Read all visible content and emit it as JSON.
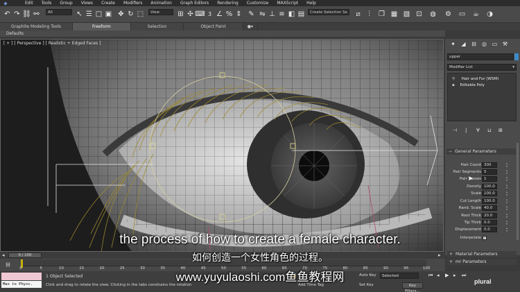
{
  "menu": [
    "Edit",
    "Tools",
    "Group",
    "Views",
    "Create",
    "Modifiers",
    "Animation",
    "Graph Editors",
    "Rendering",
    "Customize",
    "MAXScript",
    "Help"
  ],
  "toolbar": {
    "filter_all": "All",
    "view_select": "View",
    "selection_set": "Create Selection Se",
    "snap_num": "3"
  },
  "ribbon_tabs": [
    "Graphite Modeling Tools",
    "Freeform",
    "Selection",
    "Object Paint"
  ],
  "defaults_label": "Defaults",
  "viewport_label": "[ + ] [ Perspective ] [ Realistic + Edged Faces ]",
  "command_panel": {
    "object_name": "upper",
    "modifier_list_label": "Modifier List",
    "stack": [
      "Hair and Fur (WSM)",
      "Editable Poly"
    ],
    "rollouts": {
      "general": "General Parameters",
      "material": "Material Parameters",
      "mr": "mr Parameters"
    },
    "params": [
      {
        "label": "Hair Count",
        "value": "300"
      },
      {
        "label": "Hair Segments",
        "value": "5"
      },
      {
        "label": "Hair Passes",
        "value": "1"
      },
      {
        "label": "Density",
        "value": "100.0"
      },
      {
        "label": "Scale",
        "value": "100.0"
      },
      {
        "label": "Cut Length",
        "value": "100.0"
      },
      {
        "label": "Rand. Scale",
        "value": "40.0"
      },
      {
        "label": "Root Thick",
        "value": "20.0"
      },
      {
        "label": "Tip Thick",
        "value": "0.0"
      },
      {
        "label": "Displacement",
        "value": "0.0"
      }
    ],
    "interpolate_label": "Interpolate"
  },
  "timeline": {
    "frame_display": "0 / 100",
    "ticks": [
      "0",
      "5",
      "10",
      "15",
      "20",
      "25",
      "30",
      "35",
      "40",
      "45",
      "50",
      "55",
      "60",
      "65",
      "70",
      "75",
      "80",
      "85",
      "90",
      "95",
      "100"
    ]
  },
  "status": {
    "maxscript_label": "Max to Physc.",
    "selected_text": "1 Object Selected",
    "prompt_text": "Click and drag to rotate the view.  Clicking in the tabs constrains the rotation",
    "auto_key": "Auto Key",
    "set_key": "Set Key",
    "selected_dropdown": "Selected",
    "add_time_tag": "Add Time Tag",
    "key_filters": "Key Filters...",
    "plural_logo": "plural"
  },
  "subtitles": {
    "english": "the process of how to create a female character.",
    "chinese": "如何创造一个女性角色的过程。",
    "watermark": "www.yuyulaoshi.com鱼鱼教程网"
  }
}
